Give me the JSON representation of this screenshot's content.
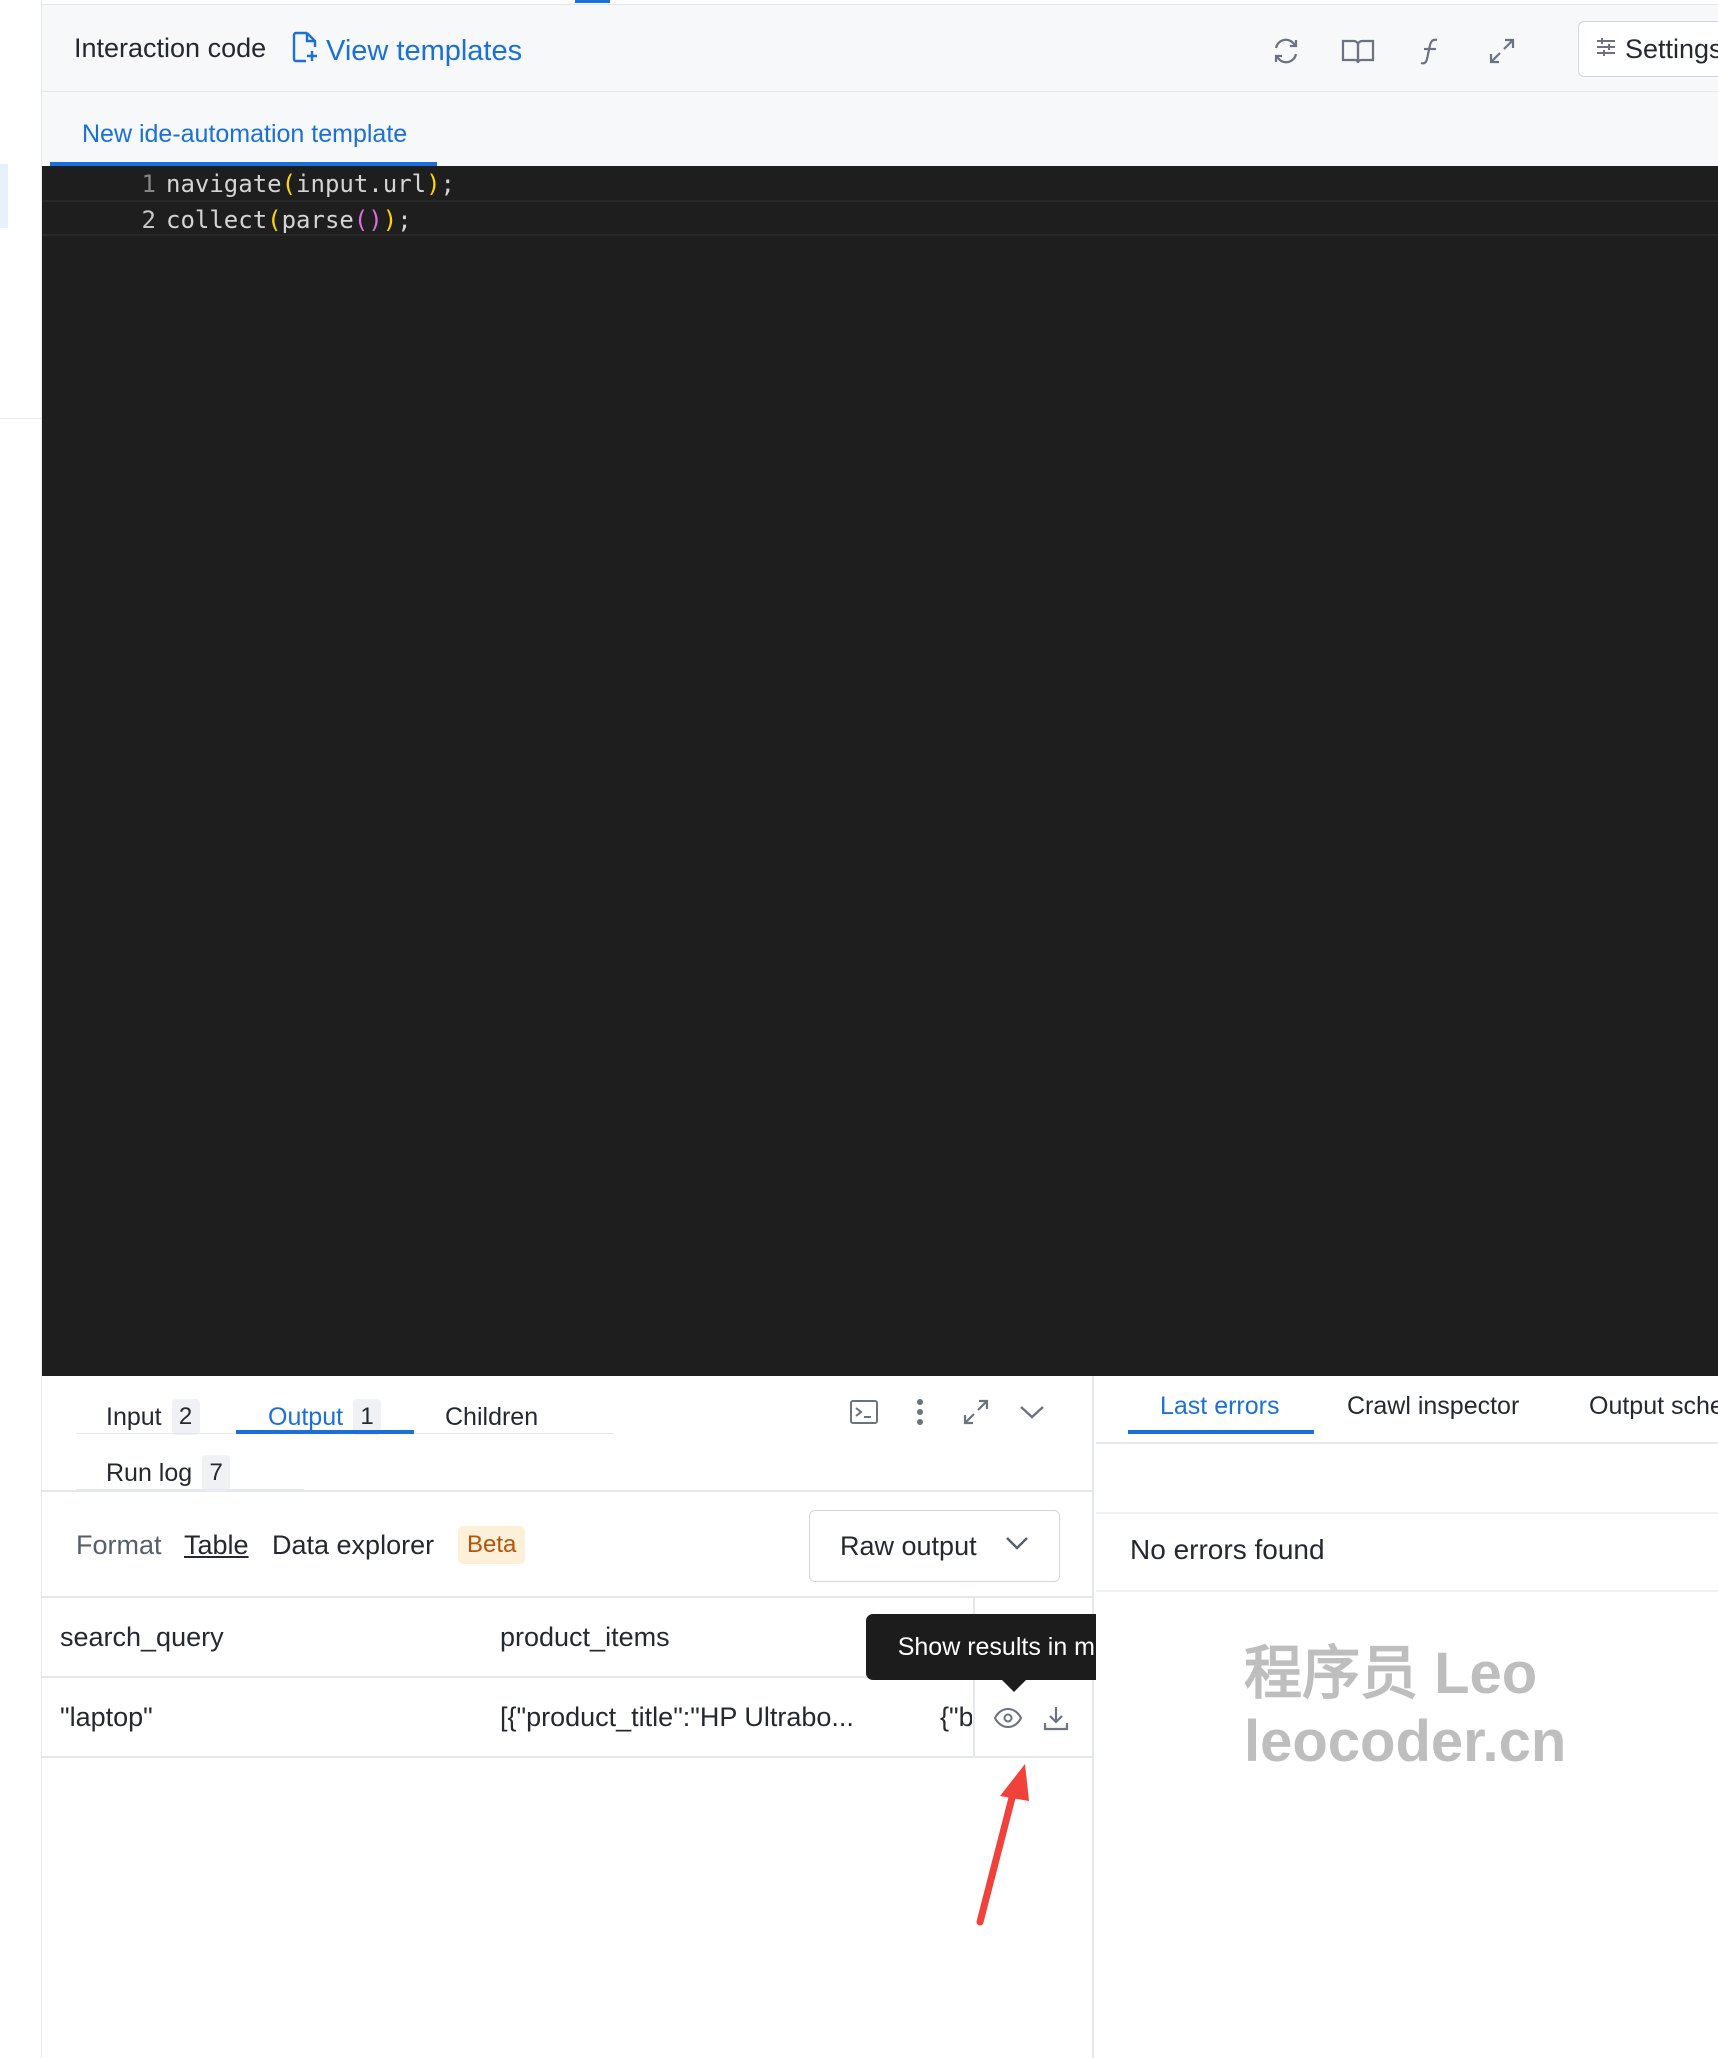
{
  "header": {
    "title": "Interaction code",
    "view_templates": "View templates",
    "settings": "Settings",
    "tools": [
      "refresh-icon",
      "book-icon",
      "function-icon",
      "expand-icon"
    ]
  },
  "template_tab": {
    "label": "New ide-automation template"
  },
  "editor": {
    "lines": [
      {
        "number": "1",
        "code": "navigate(input.url);"
      },
      {
        "number": "2",
        "code": "collect(parse());"
      }
    ]
  },
  "output_panel": {
    "tabs": [
      {
        "label": "Input",
        "count": "2"
      },
      {
        "label": "Output",
        "count": "1",
        "active": true
      },
      {
        "label": "Children"
      },
      {
        "label": "Run log",
        "count": "7"
      }
    ],
    "format": {
      "label": "Format",
      "table": "Table",
      "data_explorer": "Data explorer",
      "beta": "Beta",
      "raw_output": "Raw output"
    },
    "table": {
      "columns": [
        "search_query",
        "product_items"
      ],
      "rows": [
        {
          "search_query": "\"laptop\"",
          "product_items": "[{\"product_title\":\"HP Ultrabo...",
          "third": "{\"b"
        }
      ]
    },
    "tooltip": "Show results in modal"
  },
  "right_panel": {
    "tabs": [
      "Last errors",
      "Crawl inspector",
      "Output sche"
    ],
    "no_errors": "No errors found"
  },
  "watermark": {
    "line1": "程序员 Leo",
    "line2": "leocoder.cn"
  },
  "colors": {
    "accent": "#1a6fd8",
    "editor_bg": "#1e1e1e",
    "annotation_arrow": "#f0413b"
  }
}
